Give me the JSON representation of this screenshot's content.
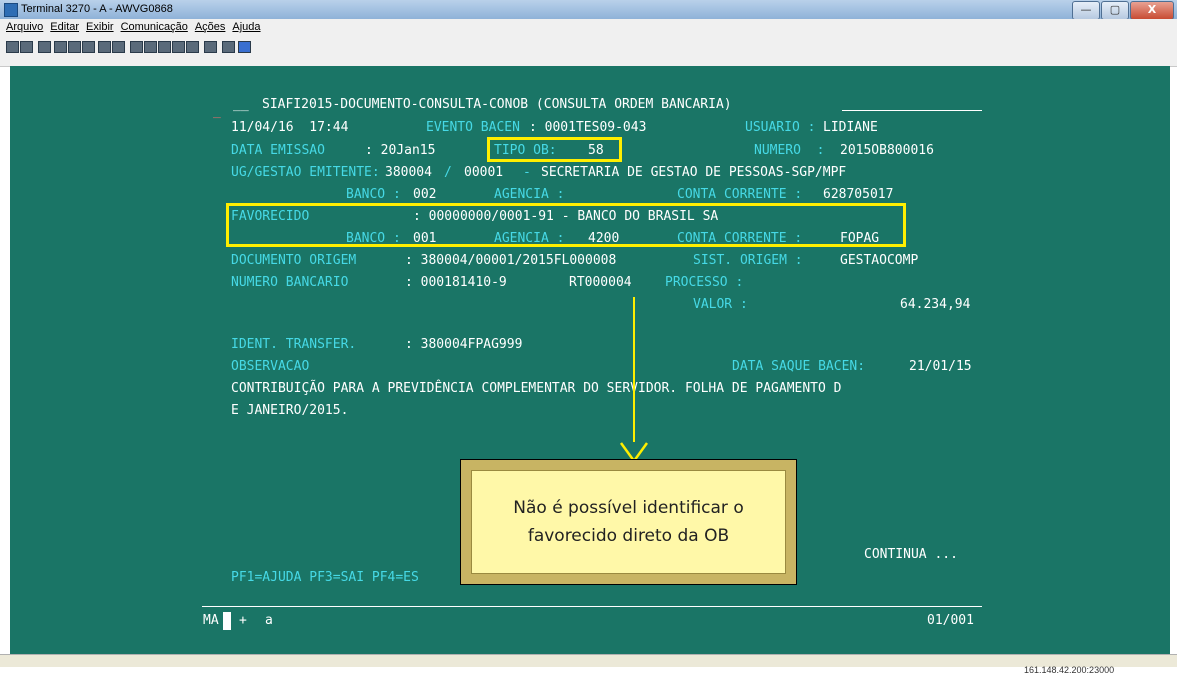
{
  "window": {
    "title": "Terminal 3270 - A - AWVG0868",
    "controls": {
      "minimize": "—",
      "maximize": "▢",
      "close": "X"
    }
  },
  "menu": [
    "Arquivo",
    "Editar",
    "Exibir",
    "Comunicação",
    "Ações",
    "Ajuda"
  ],
  "toolbar_icons": [
    "new-session-icon",
    "close-session-icon",
    "paste-icon",
    "copy-icon",
    "cut-icon",
    "print-icon",
    "macro-icon",
    "grid-icon",
    "upload-icon",
    "download-icon",
    "transfer-icon",
    "keyboard-icon",
    "play-icon",
    "settings-icon",
    "copy-screen-icon",
    "help-icon"
  ],
  "terminal": {
    "cursor_marker": "_",
    "title_prefix": "__",
    "title": "SIAFI2015-DOCUMENTO-CONSULTA-CONOB (CONSULTA ORDEM BANCARIA)",
    "date_time": "11/04/16  17:44",
    "evento_label": "EVENTO BACEN",
    "evento_value": ": 0001TES09-043",
    "usuario_label": "USUARIO :",
    "usuario_value": "LIDIANE",
    "data_emissao_label": "DATA EMISSAO",
    "data_emissao_value": ": 20Jan15",
    "tipo_ob_label": "TIPO OB:",
    "tipo_ob_value": "58",
    "numero_label": "NUMERO  :",
    "numero_value": "2015OB800016",
    "ug_label": "UG/GESTAO EMITENTE:",
    "ug_value": "380004",
    "ug_sep": "/",
    "gestao_value": "00001",
    "ug_dash": "-",
    "ug_name": "SECRETARIA DE GESTAO DE PESSOAS-SGP/MPF",
    "banco_label": "BANCO :",
    "banco_value": "002",
    "agencia_label": "AGENCIA :",
    "conta_label": "CONTA CORRENTE :",
    "conta_value": "628705017",
    "favorecido_label": "FAVORECIDO",
    "favorecido_value": ": 00000000/0001-91 - BANCO DO BRASIL SA",
    "fav_banco_label": "BANCO :",
    "fav_banco_value": "001",
    "fav_agencia_label": "AGENCIA :",
    "fav_agencia_value": "4200",
    "fav_conta_label": "CONTA CORRENTE :",
    "fav_conta_value": "FOPAG",
    "doc_origem_label": "DOCUMENTO ORIGEM",
    "doc_origem_value": ": 380004/00001/2015FL000008",
    "sist_origem_label": "SIST. ORIGEM :",
    "sist_origem_value": "GESTAOCOMP",
    "num_bancario_label": "NUMERO BANCARIO",
    "num_bancario_value": ": 000181410-9",
    "rt_value": "RT000004",
    "processo_label": "PROCESSO :",
    "valor_label": "VALOR :",
    "valor_value": "64.234,94",
    "ident_label": "IDENT. TRANSFER.",
    "ident_value": ": 380004FPAG999",
    "observacao_label": "OBSERVACAO",
    "data_saque_label": "DATA SAQUE BACEN:",
    "data_saque_value": "21/01/15",
    "obs_line1": "CONTRIBUIÇÃO PARA A PREVIDÊNCIA COMPLEMENTAR DO SERVIDOR. FOLHA DE PAGAMENTO D",
    "obs_line2": "E JANEIRO/2015.",
    "continua": "CONTINUA ...",
    "pf_keys": "PF1=AJUDA PF3=SAI PF4=ES",
    "cmd_prefix": "MA",
    "cmd_plus": "+",
    "cmd_text": "a",
    "page": "01/001"
  },
  "callout": {
    "line1": "Não é possível identificar o",
    "line2": "favorecido direto da OB"
  },
  "status": {
    "ip": "161.148.42.200:23000"
  },
  "colors": {
    "terminal_bg": "#1a7566",
    "label_cyan": "#46d9e6",
    "highlight_yellow": "#ffee00",
    "callout_bg": "#fff8a8"
  }
}
